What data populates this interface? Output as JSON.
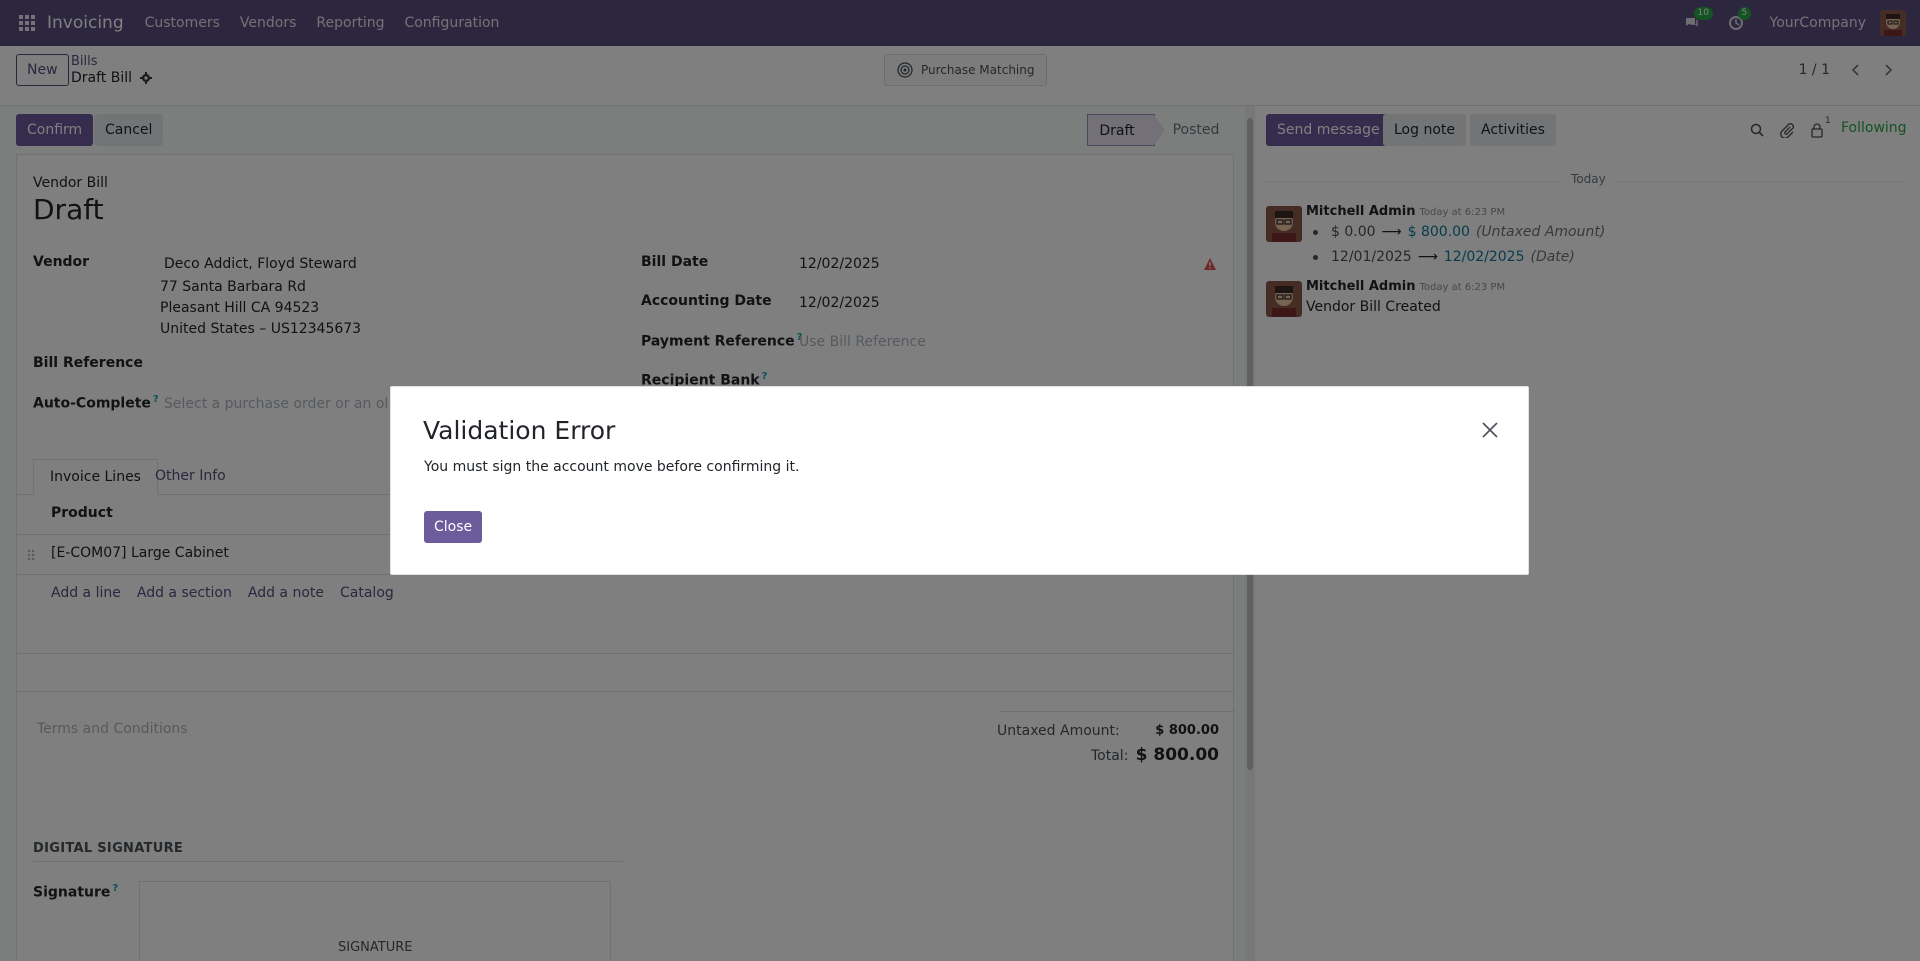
{
  "navbar": {
    "brand": "Invoicing",
    "menu": [
      "Customers",
      "Vendors",
      "Reporting",
      "Configuration"
    ],
    "messages_count": "10",
    "activities_count": "5",
    "company": "YourCompany",
    "color": "#594d7c"
  },
  "control_panel": {
    "new_label": "New",
    "breadcrumb_parent": "Bills",
    "breadcrumb_current": "Draft Bill",
    "smart_button": "Purchase Matching",
    "pager": "1 / 1"
  },
  "statusbar": {
    "confirm_label": "Confirm",
    "cancel_label": "Cancel",
    "stages": [
      "Draft",
      "Posted"
    ],
    "active_stage": "Draft"
  },
  "form": {
    "doc_type": "Vendor Bill",
    "title": "Draft",
    "vendor_label": "Vendor",
    "vendor_name": "Deco Addict, Floyd Steward",
    "vendor_address": [
      "77 Santa Barbara Rd",
      "Pleasant Hill CA 94523",
      "United States – US12345673"
    ],
    "bill_reference_label": "Bill Reference",
    "auto_complete_label": "Auto-Complete",
    "auto_complete_placeholder": "Select a purchase order or an old bill",
    "bill_date_label": "Bill Date",
    "bill_date": "12/02/2025",
    "accounting_date_label": "Accounting Date",
    "accounting_date": "12/02/2025",
    "payment_reference_label": "Payment Reference",
    "payment_reference_placeholder": "Use Bill Reference",
    "recipient_bank_label": "Recipient Bank",
    "tabs": [
      "Invoice Lines",
      "Other Info"
    ],
    "product_header": "Product",
    "lines": [
      "[E-COM07] Large Cabinet"
    ],
    "add_links": [
      "Add a line",
      "Add a section",
      "Add a note",
      "Catalog"
    ],
    "terms_placeholder": "Terms and Conditions",
    "untaxed_label": "Untaxed Amount:",
    "untaxed_value": "$ 800.00",
    "total_label": "Total:",
    "total_value": "$ 800.00",
    "digital_signature_title": "DIGITAL SIGNATURE",
    "signature_label": "Signature",
    "signature_placeholder": "SIGNATURE"
  },
  "chatter": {
    "send_message": "Send message",
    "log_note": "Log note",
    "activities": "Activities",
    "followers_count": "1",
    "following": "Following",
    "today": "Today",
    "messages": [
      {
        "author": "Mitchell Admin",
        "time": "Today at 6:23 PM",
        "changes": [
          {
            "old": "$ 0.00",
            "new": "$ 800.00",
            "field": "(Untaxed Amount)"
          },
          {
            "old": "12/01/2025",
            "new": "12/02/2025",
            "field": "(Date)"
          }
        ]
      },
      {
        "author": "Mitchell Admin",
        "time": "Today at 6:23 PM",
        "body": "Vendor Bill Created"
      }
    ]
  },
  "modal": {
    "title": "Validation Error",
    "body": "You must sign the account move before confirming it.",
    "close_label": "Close"
  }
}
